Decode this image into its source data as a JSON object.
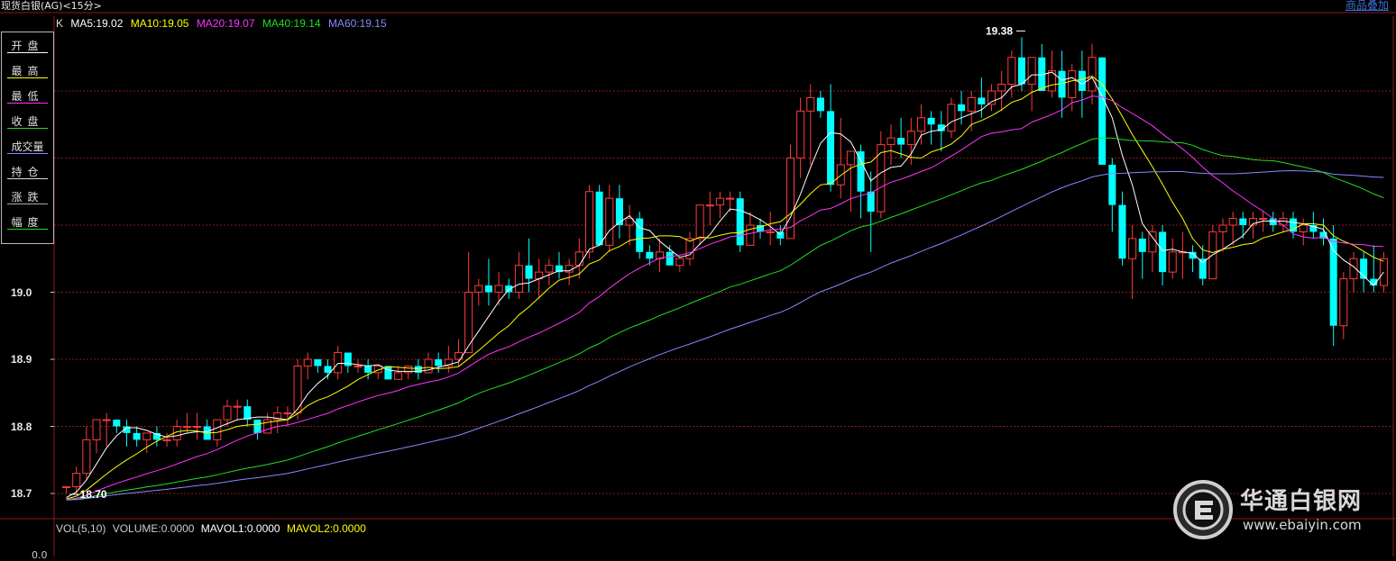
{
  "app": {
    "title": "现货白银(AG)<15分>",
    "overlay_button": "商品叠加"
  },
  "ma_legend": {
    "prefix": "K",
    "items": [
      {
        "label": "MA5:19.02",
        "color": "#ffffff"
      },
      {
        "label": "MA10:19.05",
        "color": "#ffff00"
      },
      {
        "label": "MA20:19.07",
        "color": "#ff33ff"
      },
      {
        "label": "MA40:19.14",
        "color": "#22dd22"
      },
      {
        "label": "MA60:19.15",
        "color": "#8888ff"
      }
    ]
  },
  "side_panel": {
    "items": [
      {
        "label": "开盘",
        "line_color": "#ffffff"
      },
      {
        "label": "最高",
        "line_color": "#ffff00"
      },
      {
        "label": "最低",
        "line_color": "#ff33ff"
      },
      {
        "label": "收盘",
        "line_color": "#22dd22"
      },
      {
        "label": "成交量",
        "line_color": "#8888ff"
      },
      {
        "label": "持仓",
        "line_color": "#dddddd"
      },
      {
        "label": "涨跌",
        "line_color": "#aaaaaa"
      },
      {
        "label": "幅度",
        "line_color": "#22dd22"
      }
    ]
  },
  "annotations": {
    "high": "19.38",
    "low": "18.70"
  },
  "volume_legend": {
    "items": [
      {
        "label": "VOL(5,10)",
        "color": "#cccccc"
      },
      {
        "label": "VOLUME:0.0000",
        "color": "#cccccc"
      },
      {
        "label": "MAVOL1:0.0000",
        "color": "#ffffff"
      },
      {
        "label": "MAVOL2:0.0000",
        "color": "#ffff00"
      }
    ]
  },
  "bottom_axis_value": "0.0",
  "watermark": {
    "name": "华通白银网",
    "url": "www.ebaiyin.com"
  },
  "colors": {
    "up": "#ff3b3b",
    "down": "#00ffff",
    "grid": "#8b1a1a"
  },
  "chart_data": {
    "type": "candlestick",
    "y_ticks": [
      "19.0",
      "18.9",
      "18.8",
      "18.7"
    ],
    "ylim": [
      18.68,
      19.42
    ],
    "grid": true,
    "candles": [
      [
        18.71,
        18.71,
        18.7,
        18.71
      ],
      [
        18.71,
        18.74,
        18.7,
        18.73
      ],
      [
        18.73,
        18.8,
        18.72,
        18.78
      ],
      [
        18.78,
        18.81,
        18.76,
        18.81
      ],
      [
        18.81,
        18.82,
        18.77,
        18.81
      ],
      [
        18.81,
        18.81,
        18.79,
        18.8
      ],
      [
        18.8,
        18.81,
        18.77,
        18.79
      ],
      [
        18.79,
        18.8,
        18.77,
        18.78
      ],
      [
        18.78,
        18.79,
        18.76,
        18.79
      ],
      [
        18.79,
        18.8,
        18.77,
        18.78
      ],
      [
        18.78,
        18.79,
        18.77,
        18.78
      ],
      [
        18.78,
        18.81,
        18.77,
        18.8
      ],
      [
        18.8,
        18.82,
        18.79,
        18.8
      ],
      [
        18.8,
        18.82,
        18.78,
        18.8
      ],
      [
        18.8,
        18.81,
        18.78,
        18.78
      ],
      [
        18.78,
        18.81,
        18.77,
        18.81
      ],
      [
        18.81,
        18.84,
        18.8,
        18.83
      ],
      [
        18.83,
        18.84,
        18.81,
        18.83
      ],
      [
        18.83,
        18.84,
        18.8,
        18.81
      ],
      [
        18.81,
        18.81,
        18.78,
        18.79
      ],
      [
        18.79,
        18.82,
        18.79,
        18.81
      ],
      [
        18.81,
        18.83,
        18.79,
        18.82
      ],
      [
        18.82,
        18.83,
        18.8,
        18.82
      ],
      [
        18.82,
        18.9,
        18.81,
        18.89
      ],
      [
        18.89,
        18.91,
        18.87,
        18.9
      ],
      [
        18.9,
        18.9,
        18.88,
        18.89
      ],
      [
        18.89,
        18.9,
        18.87,
        18.88
      ],
      [
        18.88,
        18.92,
        18.87,
        18.91
      ],
      [
        18.91,
        18.91,
        18.88,
        18.89
      ],
      [
        18.89,
        18.9,
        18.88,
        18.89
      ],
      [
        18.89,
        18.9,
        18.87,
        18.88
      ],
      [
        18.88,
        18.89,
        18.87,
        18.89
      ],
      [
        18.89,
        18.89,
        18.87,
        18.87
      ],
      [
        18.87,
        18.89,
        18.87,
        18.88
      ],
      [
        18.88,
        18.89,
        18.87,
        18.89
      ],
      [
        18.89,
        18.9,
        18.87,
        18.88
      ],
      [
        18.88,
        18.91,
        18.88,
        18.9
      ],
      [
        18.9,
        18.91,
        18.88,
        18.89
      ],
      [
        18.89,
        18.92,
        18.88,
        18.9
      ],
      [
        18.9,
        18.93,
        18.89,
        18.91
      ],
      [
        18.91,
        19.06,
        18.91,
        19.0
      ],
      [
        19.0,
        19.02,
        18.98,
        19.01
      ],
      [
        19.01,
        19.05,
        18.98,
        19.0
      ],
      [
        19.0,
        19.03,
        18.98,
        19.01
      ],
      [
        19.01,
        19.02,
        18.99,
        19.0
      ],
      [
        19.0,
        19.06,
        18.99,
        19.04
      ],
      [
        19.04,
        19.08,
        19.0,
        19.02
      ],
      [
        19.02,
        19.05,
        18.99,
        19.03
      ],
      [
        19.03,
        19.05,
        19.01,
        19.04
      ],
      [
        19.04,
        19.06,
        19.02,
        19.03
      ],
      [
        19.03,
        19.05,
        19.01,
        19.04
      ],
      [
        19.04,
        19.08,
        19.02,
        19.06
      ],
      [
        19.06,
        19.16,
        19.05,
        19.15
      ],
      [
        19.15,
        19.16,
        19.07,
        19.07
      ],
      [
        19.07,
        19.16,
        19.06,
        19.14
      ],
      [
        19.14,
        19.16,
        19.08,
        19.1
      ],
      [
        19.1,
        19.13,
        19.07,
        19.11
      ],
      [
        19.11,
        19.12,
        19.05,
        19.06
      ],
      [
        19.06,
        19.07,
        19.04,
        19.05
      ],
      [
        19.05,
        19.08,
        19.03,
        19.06
      ],
      [
        19.06,
        19.07,
        19.04,
        19.04
      ],
      [
        19.04,
        19.05,
        19.03,
        19.05
      ],
      [
        19.05,
        19.09,
        19.04,
        19.08
      ],
      [
        19.08,
        19.13,
        19.07,
        19.13
      ],
      [
        19.13,
        19.15,
        19.1,
        19.13
      ],
      [
        19.13,
        19.15,
        19.11,
        19.14
      ],
      [
        19.14,
        19.15,
        19.12,
        19.14
      ],
      [
        19.14,
        19.15,
        19.06,
        19.07
      ],
      [
        19.07,
        19.12,
        19.07,
        19.1
      ],
      [
        19.1,
        19.11,
        19.08,
        19.09
      ],
      [
        19.09,
        19.12,
        19.07,
        19.09
      ],
      [
        19.09,
        19.1,
        19.07,
        19.08
      ],
      [
        19.08,
        19.22,
        19.08,
        19.2
      ],
      [
        19.2,
        19.29,
        19.17,
        19.27
      ],
      [
        19.27,
        19.31,
        19.19,
        19.29
      ],
      [
        19.29,
        19.3,
        19.26,
        19.27
      ],
      [
        19.27,
        19.31,
        19.15,
        19.16
      ],
      [
        19.16,
        19.26,
        19.14,
        19.19
      ],
      [
        19.19,
        19.21,
        19.12,
        19.21
      ],
      [
        19.21,
        19.22,
        19.11,
        19.15
      ],
      [
        19.15,
        19.18,
        19.06,
        19.12
      ],
      [
        19.12,
        19.24,
        19.11,
        19.22
      ],
      [
        19.22,
        19.25,
        19.19,
        19.23
      ],
      [
        19.23,
        19.26,
        19.2,
        19.22
      ],
      [
        19.22,
        19.26,
        19.19,
        19.24
      ],
      [
        19.24,
        19.28,
        19.22,
        19.26
      ],
      [
        19.26,
        19.27,
        19.22,
        19.25
      ],
      [
        19.25,
        19.27,
        19.21,
        19.24
      ],
      [
        19.24,
        19.29,
        19.23,
        19.28
      ],
      [
        19.28,
        19.3,
        19.25,
        19.27
      ],
      [
        19.27,
        19.3,
        19.24,
        19.29
      ],
      [
        19.29,
        19.32,
        19.26,
        19.28
      ],
      [
        19.28,
        19.31,
        19.27,
        19.3
      ],
      [
        19.3,
        19.33,
        19.27,
        19.31
      ],
      [
        19.31,
        19.36,
        19.29,
        19.35
      ],
      [
        19.35,
        19.38,
        19.3,
        19.31
      ],
      [
        19.31,
        19.34,
        19.27,
        19.35
      ],
      [
        19.35,
        19.37,
        19.3,
        19.3
      ],
      [
        19.3,
        19.36,
        19.29,
        19.33
      ],
      [
        19.33,
        19.36,
        19.26,
        19.29
      ],
      [
        19.29,
        19.34,
        19.27,
        19.33
      ],
      [
        19.33,
        19.36,
        19.26,
        19.3
      ],
      [
        19.3,
        19.37,
        19.28,
        19.35
      ],
      [
        19.35,
        19.35,
        19.19,
        19.19
      ],
      [
        19.19,
        19.2,
        19.09,
        19.13
      ],
      [
        19.13,
        19.15,
        19.04,
        19.05
      ],
      [
        19.05,
        19.1,
        18.99,
        19.08
      ],
      [
        19.08,
        19.09,
        19.02,
        19.06
      ],
      [
        19.06,
        19.1,
        19.03,
        19.09
      ],
      [
        19.09,
        19.1,
        19.01,
        19.03
      ],
      [
        19.03,
        19.08,
        19.02,
        19.06
      ],
      [
        19.06,
        19.09,
        19.02,
        19.06
      ],
      [
        19.06,
        19.07,
        19.03,
        19.05
      ],
      [
        19.05,
        19.07,
        19.01,
        19.02
      ],
      [
        19.02,
        19.1,
        19.02,
        19.09
      ],
      [
        19.09,
        19.11,
        19.06,
        19.1
      ],
      [
        19.1,
        19.12,
        19.07,
        19.11
      ],
      [
        19.11,
        19.12,
        19.08,
        19.1
      ],
      [
        19.1,
        19.12,
        19.08,
        19.11
      ],
      [
        19.11,
        19.12,
        19.09,
        19.11
      ],
      [
        19.11,
        19.12,
        19.09,
        19.1
      ],
      [
        19.1,
        19.12,
        19.09,
        19.11
      ],
      [
        19.11,
        19.12,
        19.08,
        19.09
      ],
      [
        19.09,
        19.11,
        19.07,
        19.1
      ],
      [
        19.1,
        19.12,
        19.08,
        19.09
      ],
      [
        19.09,
        19.11,
        19.07,
        19.08
      ],
      [
        19.08,
        19.1,
        18.92,
        18.95
      ],
      [
        18.95,
        19.03,
        18.93,
        19.02
      ],
      [
        19.02,
        19.06,
        19.0,
        19.05
      ],
      [
        19.05,
        19.06,
        19.0,
        19.02
      ],
      [
        19.02,
        19.07,
        19.0,
        19.01
      ],
      [
        19.01,
        19.06,
        19.0,
        19.05
      ]
    ]
  }
}
